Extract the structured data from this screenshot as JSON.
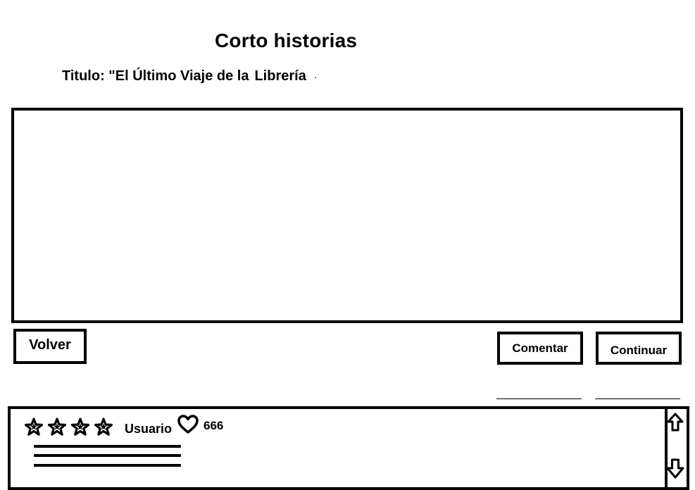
{
  "header": {
    "title": "Corto historias",
    "story_title_prefix": "Titulo: \"El Último Viaje de la",
    "story_title_suffix": "Librería",
    "story_title_trailing": "."
  },
  "story": {
    "content": ""
  },
  "actions": {
    "back_label": "Volver",
    "comment_label": "Comentar",
    "continue_label": "Continuar"
  },
  "comment": {
    "rating": 4,
    "user": "Usuario",
    "likes": "666",
    "text_lines": 3
  },
  "icons": {
    "rating": "star-icon",
    "like": "heart-icon",
    "scroll_up": "arrow-up-icon",
    "scroll_down": "arrow-down-icon"
  }
}
